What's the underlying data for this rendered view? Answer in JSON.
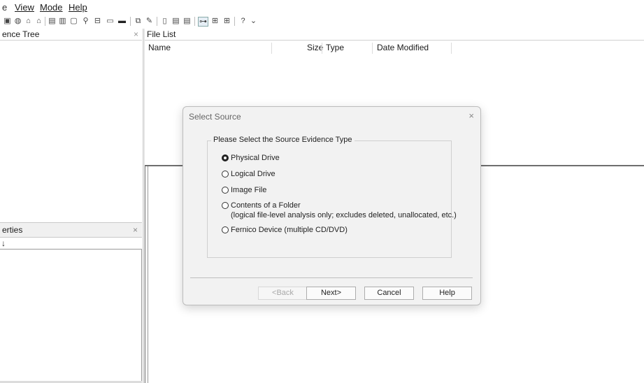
{
  "menu": {
    "lead_fragment": "e",
    "items": [
      {
        "label": "View"
      },
      {
        "label": "Mode"
      },
      {
        "label": "Help"
      }
    ]
  },
  "toolbar": {
    "icons": [
      "open-case-icon",
      "add-evidence-icon",
      "remove-evidence-icon",
      "evidence-options-icon",
      "print-icon",
      "save-icon",
      "save-as-icon",
      "scan-icon",
      "scan-options-icon",
      "eject-icon",
      "drive-icon",
      "find-icon",
      "search-icon",
      "new-page-icon",
      "report-icon",
      "list-icon",
      "preview-icon",
      "tree-view-icon",
      "multi-view-icon",
      "help-icon",
      "toolbar-options-icon"
    ]
  },
  "evidence_tree": {
    "title": "ence Tree",
    "close": "×"
  },
  "file_list": {
    "title": "File List",
    "columns": [
      "Name",
      "Size",
      "Type",
      "Date Modified"
    ]
  },
  "properties": {
    "title": "erties",
    "close": "×",
    "sort_glyph": "↓"
  },
  "dialog": {
    "title": "Select Source",
    "close": "×",
    "group_title": "Please Select the Source Evidence Type",
    "options": [
      {
        "label": "Physical Drive",
        "checked": true
      },
      {
        "label": "Logical Drive",
        "checked": false
      },
      {
        "label": "Image File",
        "checked": false
      },
      {
        "label": "Contents of a Folder",
        "sublabel": "(logical file-level analysis only; excludes deleted, unallocated, etc.)",
        "checked": false
      },
      {
        "label": "Fernico Device (multiple CD/DVD)",
        "checked": false
      }
    ],
    "buttons": {
      "back": "<Back",
      "next": "Next>",
      "cancel": "Cancel",
      "help": "Help"
    }
  }
}
